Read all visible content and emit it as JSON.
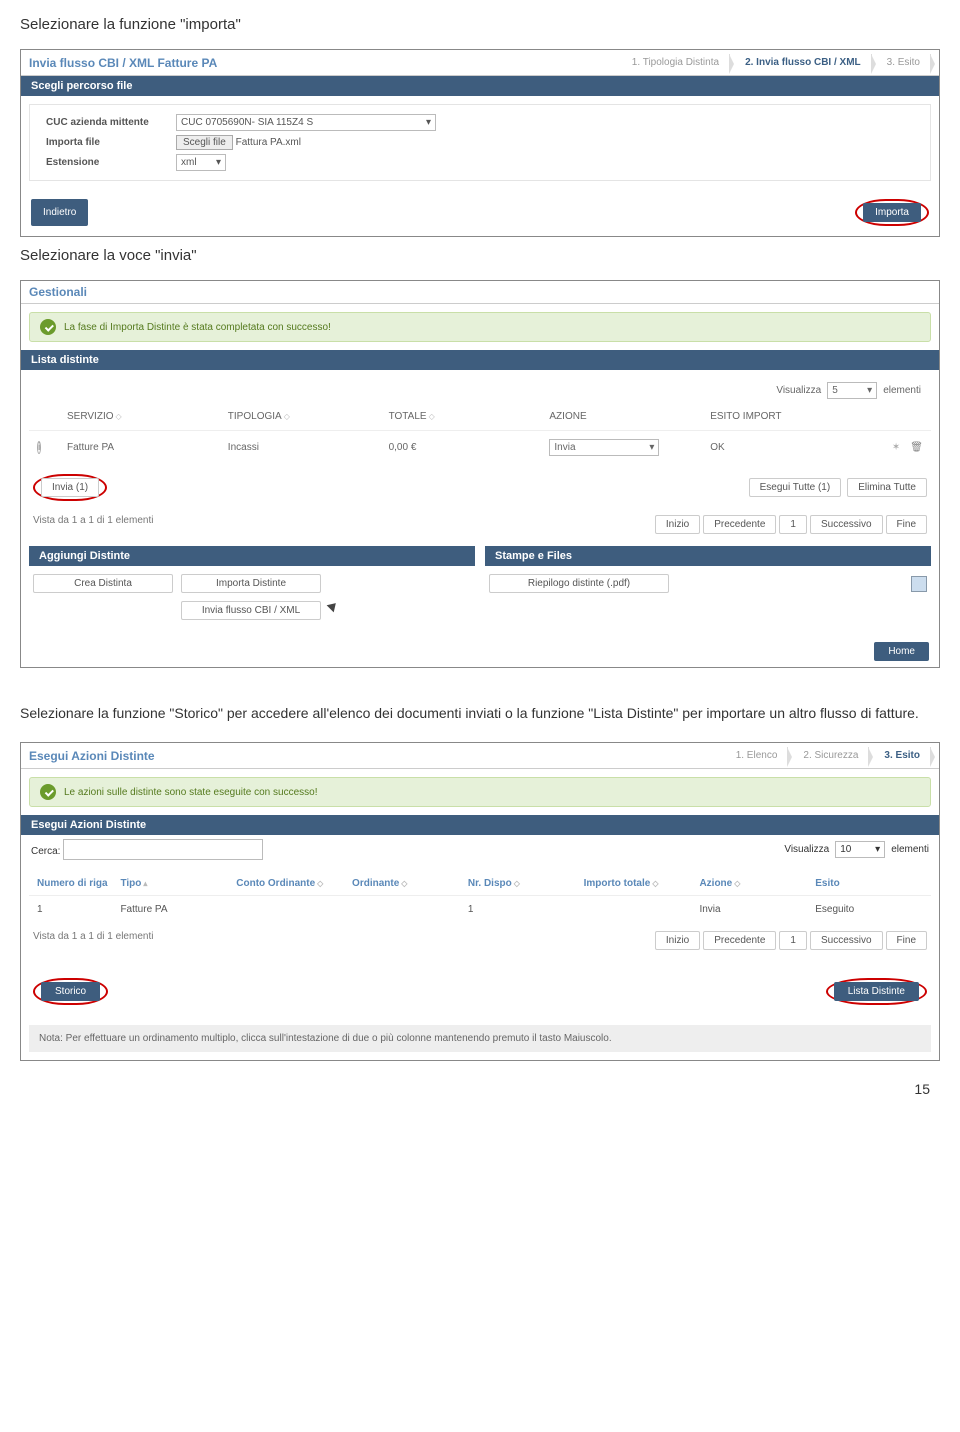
{
  "captions": {
    "first": "Selezionare la funzione \"importa\"",
    "second": "Selezionare la voce \"invia\"",
    "third": "Selezionare la funzione \"Storico\" per accedere all'elenco dei documenti inviati o la funzione \"Lista Distinte\" per importare un altro flusso di fatture."
  },
  "panel1": {
    "title": "Invia flusso CBI / XML Fatture PA",
    "steps": [
      "1. Tipologia Distinta",
      "2. Invia flusso CBI / XML",
      "3. Esito"
    ],
    "section_label": "Scegli percorso file",
    "labels": {
      "cuc": "CUC azienda mittente",
      "importa": "Importa file",
      "estensione": "Estensione"
    },
    "values": {
      "cuc": "CUC 0705690N- SIA 115Z4 S",
      "file_btn": "Scegli file",
      "file_name": "Fattura PA.xml",
      "est": "xml"
    },
    "btn_back": "Indietro",
    "btn_import": "Importa"
  },
  "panel2": {
    "title": "Gestionali",
    "success": "La fase di Importa Distinte è stata completata con successo!",
    "darkbar": "Lista distinte",
    "visualizza": "Visualizza",
    "vis_val": "5",
    "elementi": "elementi",
    "headers": {
      "servizio": "SERVIZIO",
      "tipologia": "TIPOLOGIA",
      "totale": "TOTALE",
      "azione": "AZIONE",
      "esito": "ESITO IMPORT"
    },
    "row": {
      "servizio": "Fatture PA",
      "tipologia": "Incassi",
      "totale": "0,00 €",
      "azione": "Invia",
      "esito": "OK"
    },
    "invia_btn": "Invia (1)",
    "esegui_btn": "Esegui Tutte (1)",
    "elimina_btn": "Elimina Tutte",
    "vista_label": "Vista da 1 a 1 di 1 elementi",
    "pagin": {
      "inizio": "Inizio",
      "prec": "Precedente",
      "page": "1",
      "succ": "Successivo",
      "fine": "Fine"
    },
    "aggiungi_bar": "Aggiungi Distinte",
    "stampe_bar": "Stampe e Files",
    "crea": "Crea Distinta",
    "importa_d": "Importa Distinte",
    "invia_flusso": "Invia flusso CBI / XML",
    "riepilogo": "Riepilogo distinte (.pdf)",
    "home": "Home"
  },
  "panel3": {
    "title": "Esegui Azioni Distinte",
    "steps": [
      "1. Elenco",
      "2. Sicurezza",
      "3. Esito"
    ],
    "success": "Le azioni sulle distinte sono state eseguite con successo!",
    "darkbar": "Esegui Azioni Distinte",
    "cerca_label": "Cerca:",
    "visualizza": "Visualizza",
    "vis_val": "10",
    "elementi": "elementi",
    "headers": {
      "num": "Numero di riga",
      "tipo": "Tipo",
      "conto": "Conto Ordinante",
      "ordinante": "Ordinante",
      "nrdispo": "Nr. Dispo",
      "importo": "Importo totale",
      "azione": "Azione",
      "esito": "Esito"
    },
    "row": {
      "num": "1",
      "tipo": "Fatture PA",
      "conto": "",
      "ordinante": "",
      "nrdispo": "1",
      "importo": "",
      "azione": "Invia",
      "esito": "Eseguito"
    },
    "vista_label": "Vista da 1 a 1 di 1 elementi",
    "pagin": {
      "inizio": "Inizio",
      "prec": "Precedente",
      "page": "1",
      "succ": "Successivo",
      "fine": "Fine"
    },
    "storico": "Storico",
    "lista_d": "Lista Distinte",
    "nota": "Nota: Per effettuare un ordinamento multiplo, clicca sull'intestazione di due o più colonne mantenendo premuto il tasto Maiuscolo."
  },
  "page_number": "15"
}
